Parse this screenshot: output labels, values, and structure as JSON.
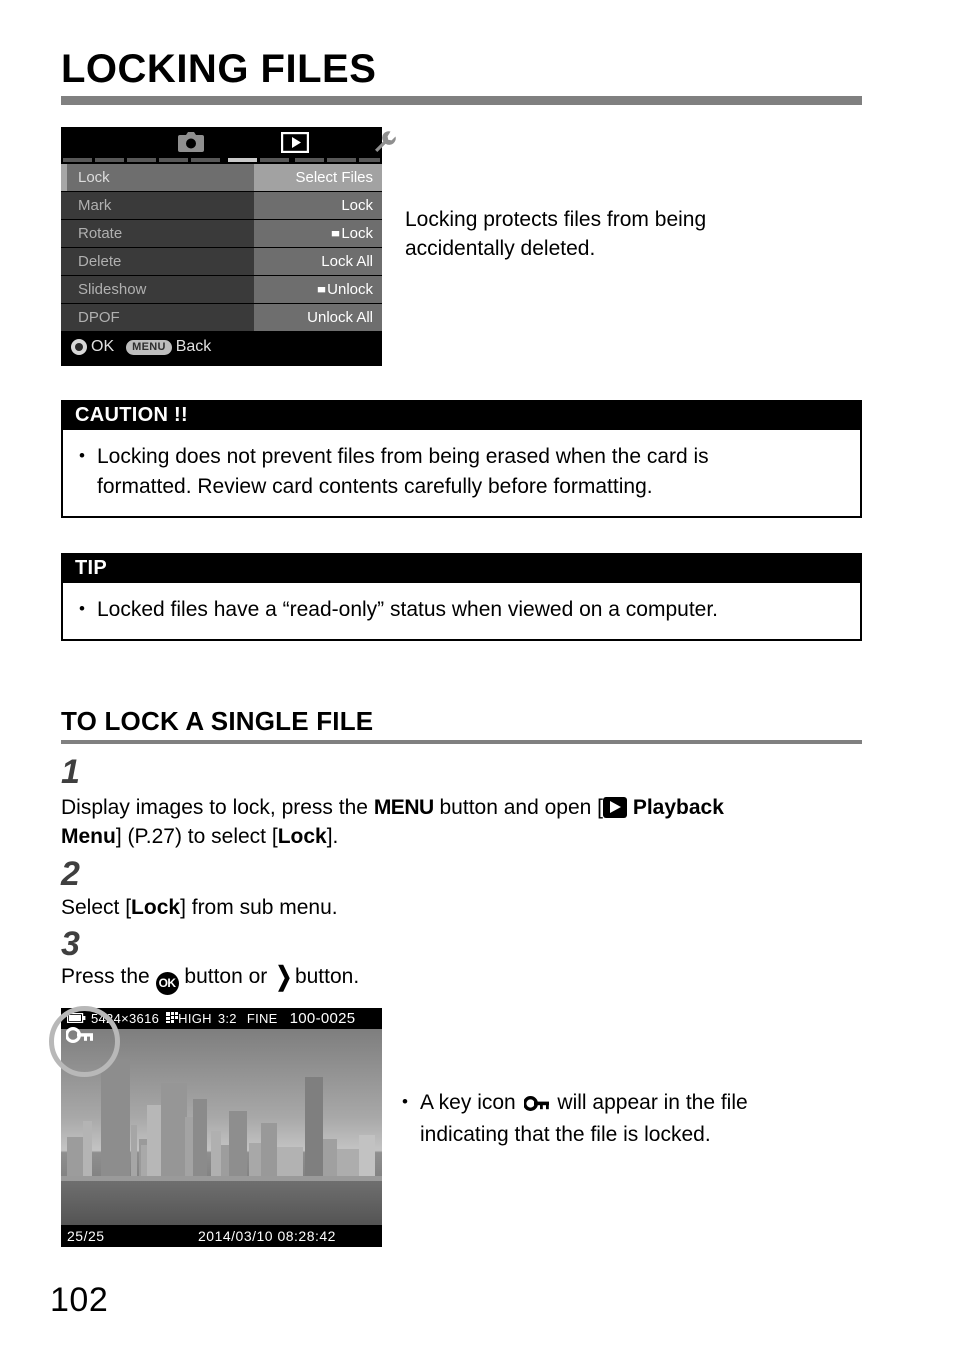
{
  "page": {
    "title": "LOCKING FILES",
    "number": "102"
  },
  "lcd_menu": {
    "tabs": [
      {
        "name": "capture-tab",
        "icon": "camera-icon",
        "active": false
      },
      {
        "name": "playback-tab",
        "icon": "playback-icon",
        "active": true
      },
      {
        "name": "setup-tab",
        "icon": "wrench-icon",
        "active": false
      }
    ],
    "rows": [
      {
        "left": "Lock",
        "right": "Select Files",
        "flag": false,
        "selected": true
      },
      {
        "left": "Mark",
        "right": "Lock",
        "flag": false,
        "selected": false
      },
      {
        "left": "Rotate",
        "right": "Lock",
        "flag": true,
        "selected": false
      },
      {
        "left": "Delete",
        "right": "Lock All",
        "flag": false,
        "selected": false
      },
      {
        "left": "Slideshow",
        "right": "Unlock",
        "flag": true,
        "selected": false
      },
      {
        "left": "DPOF",
        "right": "Unlock All",
        "flag": false,
        "selected": false
      }
    ],
    "footer": {
      "ok_label": "OK",
      "menu_label": "MENU",
      "back_label": "Back"
    }
  },
  "intro": {
    "line1": "Locking protects files from being",
    "line2": "accidentally deleted."
  },
  "caution": {
    "heading": "CAUTION !!",
    "line1": "Locking does not prevent files from being erased when the card is",
    "line2": "formatted. Review card contents carefully before formatting."
  },
  "tip": {
    "heading": "TIP",
    "line1": "Locked files have a “read-only” status when viewed on a computer."
  },
  "section": {
    "title": "TO LOCK A SINGLE FILE"
  },
  "steps": [
    {
      "number": "1",
      "text_a": "Display images to lock, press the",
      "menu_word": "MENU",
      "text_b": "button and open [",
      "playback_label": "Playback",
      "text_c": "Menu",
      "text_d": "] (P.27) to select [",
      "lock_label": "Lock",
      "text_e": "]."
    },
    {
      "number": "2",
      "text_a": "Select [",
      "lock_label": "Lock",
      "text_b": "] from sub menu."
    },
    {
      "number": "3",
      "text_a": "Press the",
      "ok_label": "OK",
      "text_b": "button or",
      "arrow": "❯",
      "text_c": "button."
    }
  ],
  "photo": {
    "resolution": "5424×3616",
    "quality": "HIGH",
    "aspect": "3:2",
    "compression": "FINE",
    "file_number": "100-0025",
    "counter": "25/25",
    "datetime": "2014/03/10 08:28:42",
    "lock_icon": "key-icon"
  },
  "photo_note": {
    "text_a": "A key icon",
    "text_b": "will appear in the file",
    "line2": "indicating that the file is locked."
  }
}
